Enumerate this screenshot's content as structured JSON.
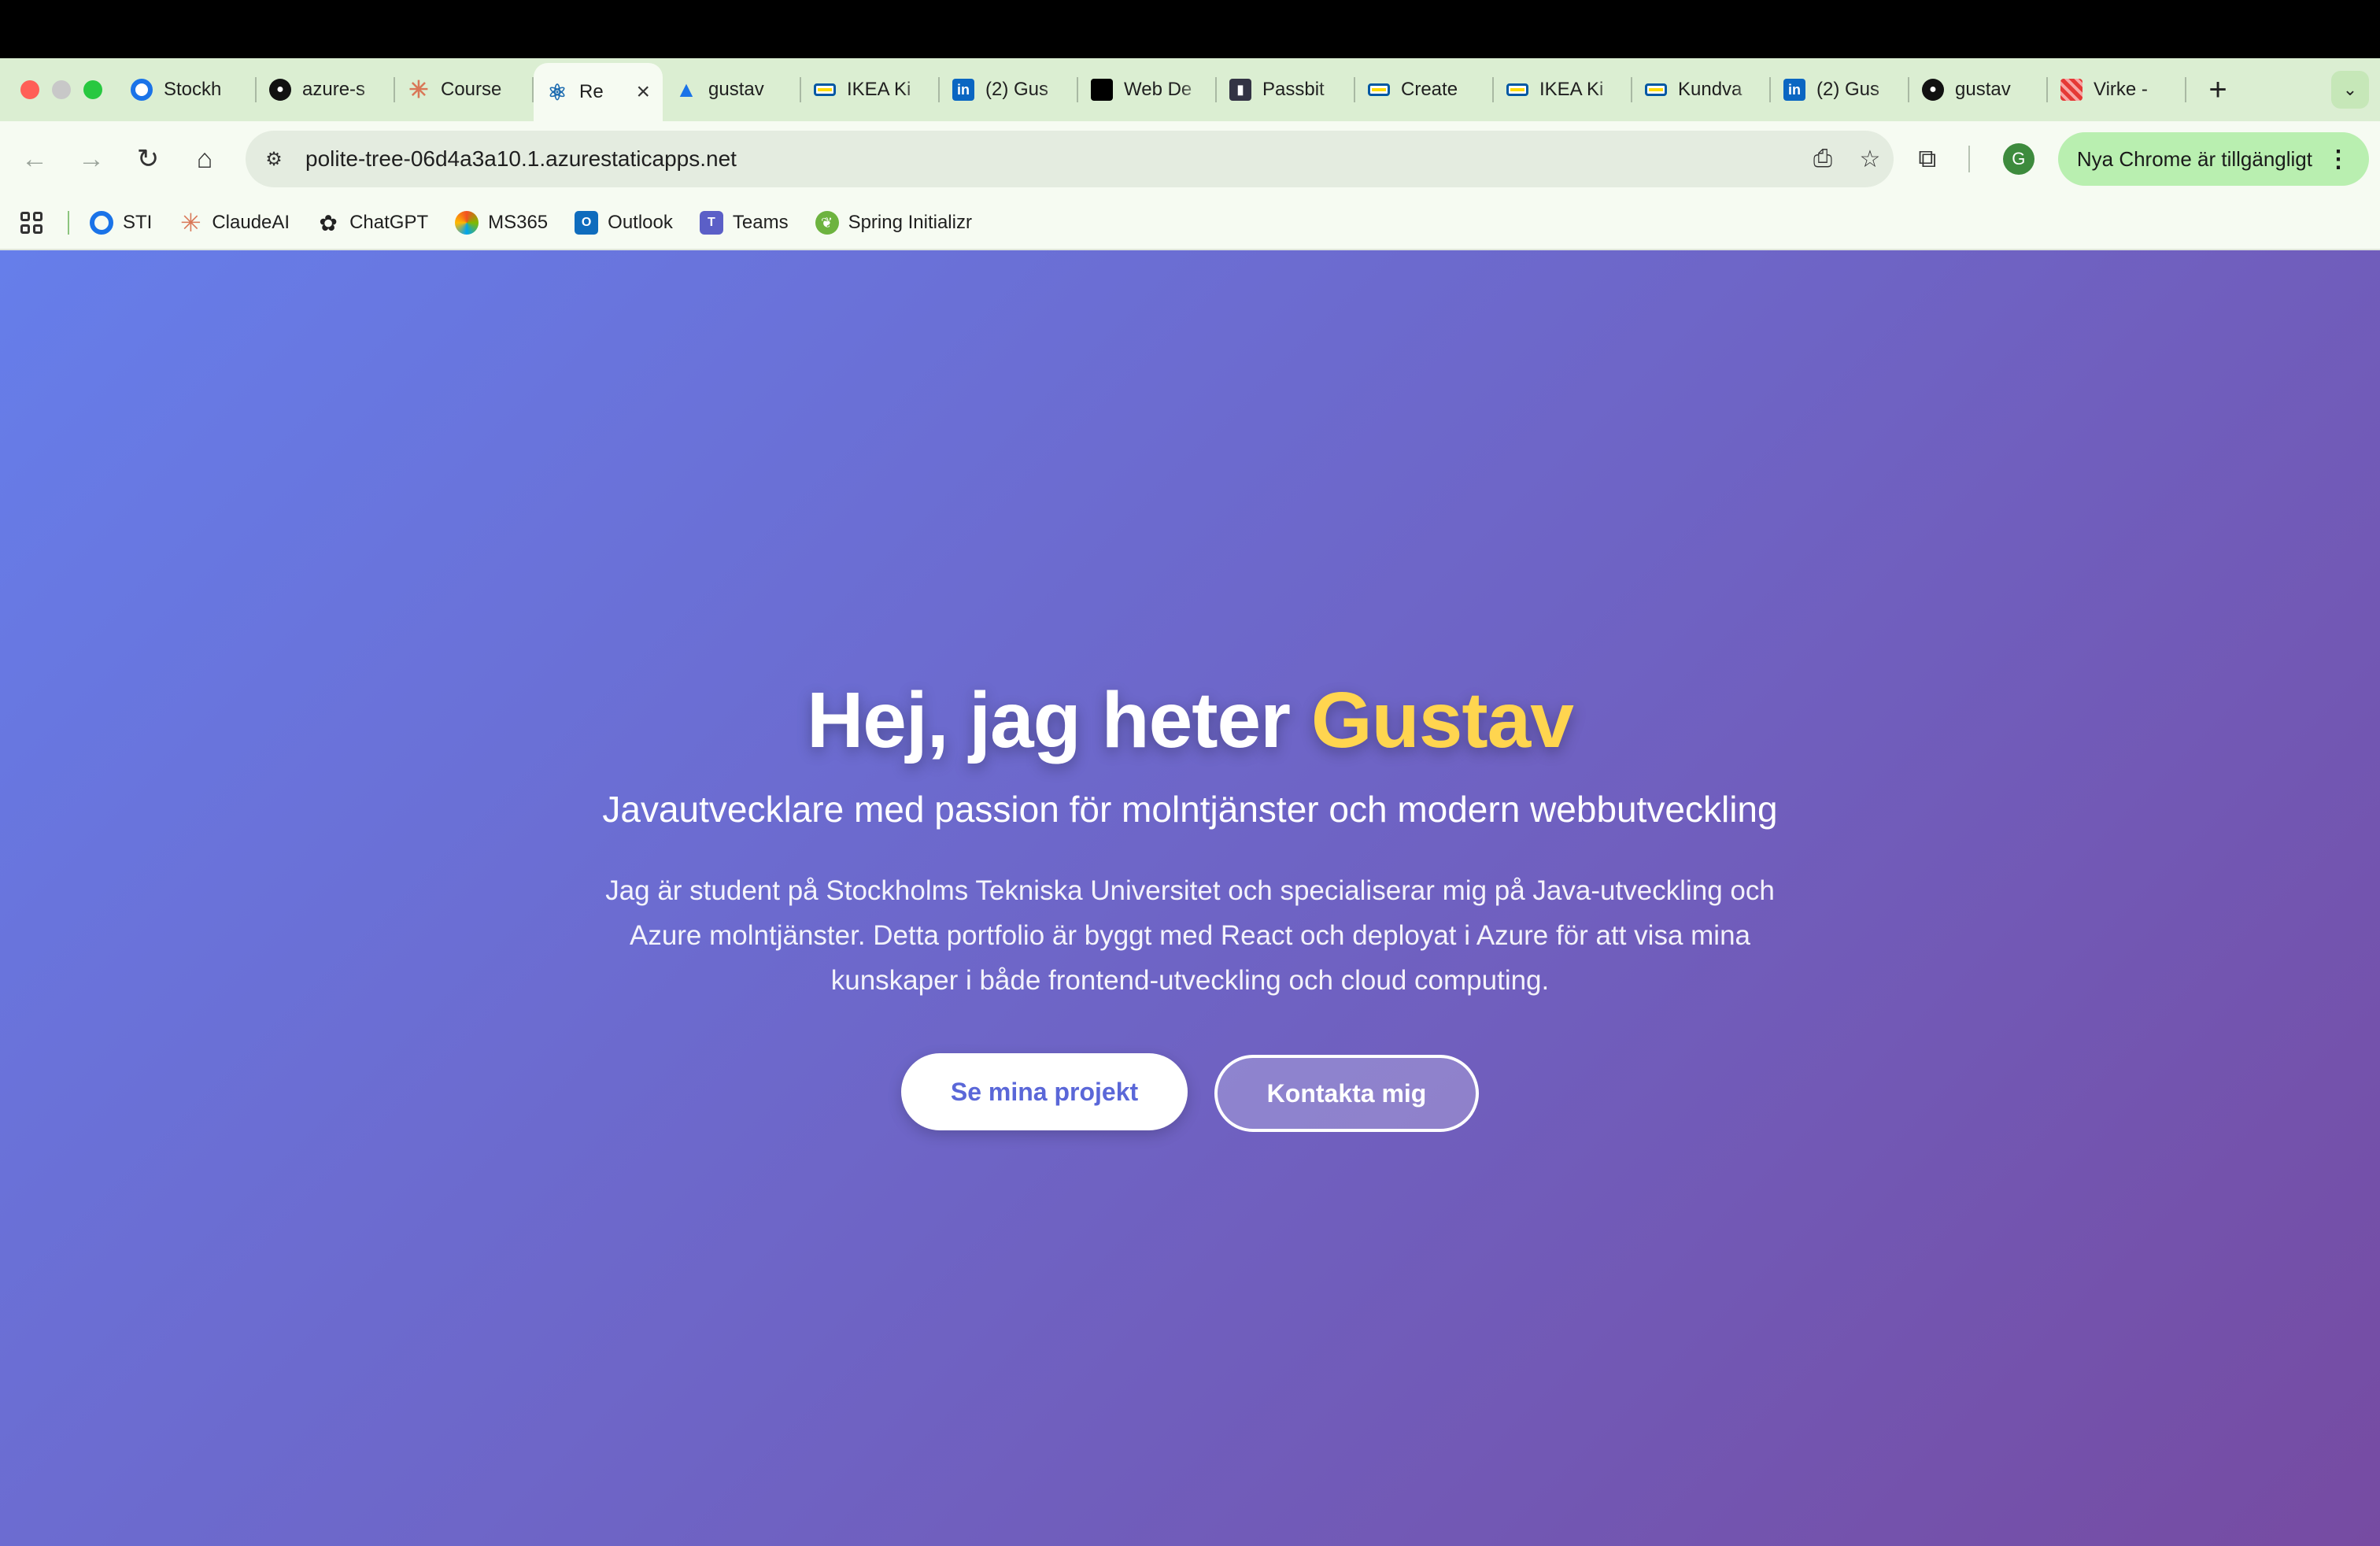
{
  "browser": {
    "tabs": [
      {
        "title": "Stockh",
        "icon": "chrome-icon"
      },
      {
        "title": "azure-s",
        "icon": "github-icon"
      },
      {
        "title": "Course",
        "icon": "claude-icon"
      },
      {
        "title": "Re",
        "icon": "react-icon",
        "active": true
      },
      {
        "title": "gustav",
        "icon": "azure-icon"
      },
      {
        "title": "IKEA Ki",
        "icon": "ikea-icon"
      },
      {
        "title": "(2) Gus",
        "icon": "linkedin-icon"
      },
      {
        "title": "Web De",
        "icon": "black-square-icon"
      },
      {
        "title": "Passbit",
        "icon": "passbit-icon"
      },
      {
        "title": "Create",
        "icon": "ikea-icon"
      },
      {
        "title": "IKEA Ki",
        "icon": "ikea-icon"
      },
      {
        "title": "Kundva",
        "icon": "ikea-icon"
      },
      {
        "title": "(2) Gus",
        "icon": "linkedin-icon"
      },
      {
        "title": "gustav",
        "icon": "github-icon"
      },
      {
        "title": "Virke -",
        "icon": "virke-icon"
      }
    ],
    "url": "polite-tree-06d4a3a10.1.azurestaticapps.net",
    "profile_initial": "G",
    "update_label": "Nya Chrome är tillgängligt",
    "bookmarks": [
      {
        "label": "STI",
        "icon": "sti-icon"
      },
      {
        "label": "ClaudeAI",
        "icon": "claude-icon"
      },
      {
        "label": "ChatGPT",
        "icon": "chatgpt-icon"
      },
      {
        "label": "MS365",
        "icon": "ms365-icon"
      },
      {
        "label": "Outlook",
        "icon": "outlook-icon"
      },
      {
        "label": "Teams",
        "icon": "teams-icon"
      },
      {
        "label": "Spring Initializr",
        "icon": "spring-icon"
      }
    ]
  },
  "hero": {
    "heading_prefix": "Hej, jag heter",
    "heading_name": "Gustav",
    "subtitle": "Javautvecklare med passion för molntjänster och modern webbutveckling",
    "description": "Jag är student på Stockholms Tekniska Universitet och specialiserar mig på Java-utveckling och Azure molntjänster. Detta portfolio är byggt med React och deployat i Azure för att visa mina kunskaper i både frontend-utveckling och cloud computing.",
    "primary_button": "Se mina projekt",
    "secondary_button": "Kontakta mig"
  },
  "colors": {
    "gradient_start": "#667eea",
    "gradient_end": "#764ba2",
    "name_accent": "#ffd54f",
    "tabstrip_bg": "#dbeed2"
  }
}
